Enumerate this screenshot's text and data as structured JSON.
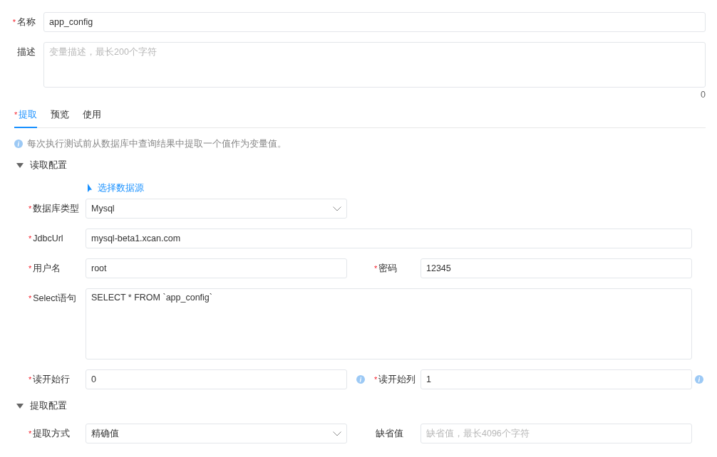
{
  "name_field": {
    "label": "名称",
    "required_mark": "*",
    "value": "app_config"
  },
  "description_field": {
    "label": "描述",
    "placeholder": "变量描述，最长200个字符",
    "counter": "0"
  },
  "tabs": [
    {
      "label": "提取",
      "required_mark": "*",
      "selected": true
    },
    {
      "label": "预览",
      "selected": false
    },
    {
      "label": "使用",
      "selected": false
    }
  ],
  "info_text": "每次执行测试前从数据库中查询结果中提取一个值作为变量值。",
  "sections": [
    {
      "title": "读取配置",
      "expanded": true,
      "link": "选择数据源",
      "rows": [
        [
          {
            "kind": "select",
            "label": "数据库类型",
            "required_mark": "*",
            "value": "Mysql"
          }
        ],
        [
          {
            "kind": "input",
            "label": "JdbcUrl",
            "required_mark": "*",
            "value": "mysql-beta1.xcan.com"
          }
        ],
        [
          {
            "kind": "input",
            "label": "用户名",
            "required_mark": "*",
            "value": "root"
          },
          {
            "kind": "input",
            "label": "密码",
            "required_mark": "*",
            "value": "12345"
          }
        ],
        [
          {
            "kind": "textarea",
            "label": "Select语句",
            "required_mark": "*",
            "value": "SELECT * FROM `app_config`"
          }
        ],
        [
          {
            "kind": "input",
            "label": "读开始行",
            "required_mark": "*",
            "value": "0",
            "info": true
          },
          {
            "kind": "input",
            "label": "读开始列",
            "required_mark": "*",
            "value": "1",
            "info": true
          }
        ]
      ]
    },
    {
      "title": "提取配置",
      "expanded": true,
      "rows": [
        [
          {
            "kind": "select",
            "label": "提取方式",
            "required_mark": "*",
            "value": "精确值"
          },
          {
            "kind": "input",
            "label": "缺省值",
            "placeholder": "缺省值，最长4096个字符"
          }
        ]
      ]
    }
  ]
}
